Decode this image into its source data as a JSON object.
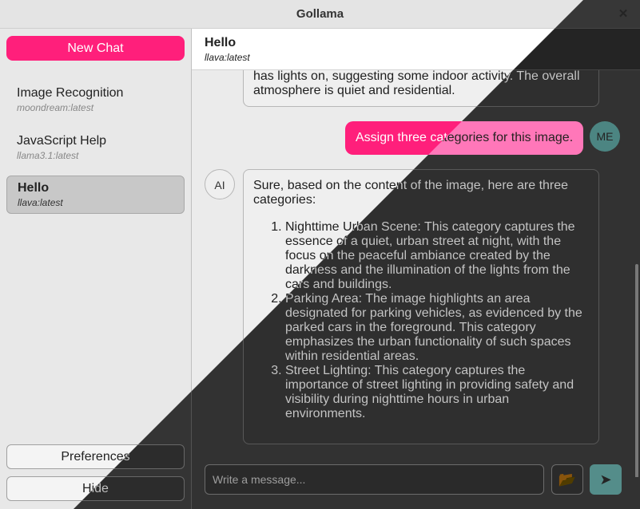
{
  "window": {
    "title": "Gollama",
    "close_glyph": "✕"
  },
  "sidebar": {
    "new_chat_label": "New Chat",
    "chats": [
      {
        "name": "Image Recognition",
        "model": "moondream:latest"
      },
      {
        "name": "JavaScript Help",
        "model": "llama3.1:latest"
      },
      {
        "name": "Hello",
        "model": "llava:latest"
      }
    ],
    "preferences_label": "Preferences",
    "hide_label": "Hide"
  },
  "chat": {
    "title": "Hello",
    "model": "llava:latest",
    "messages": {
      "prev_ai_tail": "has lights on, suggesting some indoor activity. The overall atmosphere is quiet and residential.",
      "user_message": "Assign three categories for this image.",
      "user_avatar": "ME",
      "ai_avatar": "AI",
      "ai_intro": "Sure, based on the content of the image, here are three categories:",
      "ai_items": [
        "Nighttime Urban Scene: This category captures the essence of a quiet, urban street at night, with the focus on the peaceful ambiance created by the darkness and the illumination of the lights from the cars and buildings.",
        "Parking Area: The image highlights an area designated for parking vehicles, as evidenced by the parked cars in the foreground. This category emphasizes the urban functionality of such spaces within residential areas.",
        "Street Lighting: This category captures the importance of street lighting in providing safety and visibility during nighttime hours in urban environments."
      ]
    },
    "composer": {
      "placeholder": "Write a message...",
      "attach_icon": "folder-icon",
      "send_icon": "send-icon"
    }
  },
  "colors": {
    "accent": "#ff1f7b",
    "teal": "#4a9a96",
    "dark": "#2b2b2b"
  }
}
